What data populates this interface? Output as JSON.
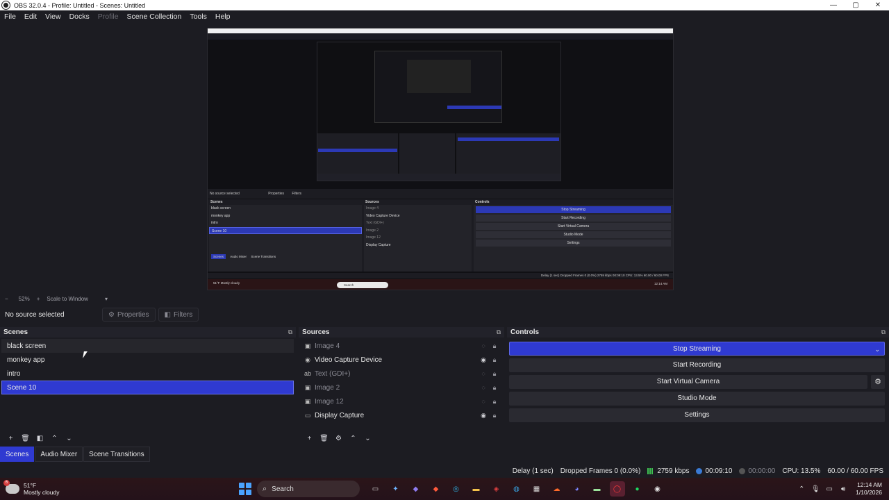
{
  "titlebar": {
    "title": "OBS 32.0.4 - Profile: Untitled - Scenes: Untitled",
    "min": "—",
    "max": "▢",
    "close": "✕"
  },
  "menu": [
    "File",
    "Edit",
    "View",
    "Docks",
    "Profile",
    "Scene Collection",
    "Tools",
    "Help"
  ],
  "menu_disabled": "Profile",
  "zoom": {
    "minus": "−",
    "percent": "52%",
    "plus": "+",
    "scale_mode": "Scale to Window",
    "caret": "▾"
  },
  "context": {
    "no_source": "No source selected",
    "properties": "Properties",
    "filters": "Filters"
  },
  "scenes": {
    "title": "Scenes",
    "items": [
      "black screen",
      "monkey app",
      "intro",
      "Scene 10"
    ],
    "selected": "Scene 10"
  },
  "sources": {
    "title": "Sources",
    "items": [
      {
        "name": "Image 4",
        "type": "image",
        "visible": false
      },
      {
        "name": "Video Capture Device",
        "type": "camera",
        "visible": true
      },
      {
        "name": "Text (GDI+)",
        "type": "text",
        "visible": false
      },
      {
        "name": "Image 2",
        "type": "image",
        "visible": false
      },
      {
        "name": "Image 12",
        "type": "image",
        "visible": false
      },
      {
        "name": "Display Capture",
        "type": "monitor",
        "visible": true
      }
    ]
  },
  "controls": {
    "title": "Controls",
    "stop_streaming": "Stop Streaming",
    "start_recording": "Start Recording",
    "start_virtual_camera": "Start Virtual Camera",
    "studio_mode": "Studio Mode",
    "settings": "Settings"
  },
  "tabs": [
    "Scenes",
    "Audio Mixer",
    "Scene Transitions"
  ],
  "status": {
    "delay": "Delay (1 sec)",
    "dropped": "Dropped Frames 0 (0.0%)",
    "bitrate": "2759 kbps",
    "stream_time": "00:09:10",
    "rec_time": "00:00:00",
    "cpu": "CPU: 13.5%",
    "fps": "60.00 / 60.00 FPS"
  },
  "taskbar": {
    "weather_temp": "51°F",
    "weather_desc": "Mostly cloudy",
    "weather_badge": "6",
    "search": "Search",
    "time": "12:14 AM",
    "date": "1/10/2026"
  },
  "preview_mini": {
    "no_source": "No source selected",
    "properties": "Properties",
    "filters": "Filters",
    "scenes_title": "Scenes",
    "sources_title": "Sources",
    "controls_title": "Controls",
    "scene_items": [
      "black screen",
      "monkey app",
      "intro",
      "Scene 10"
    ],
    "source_items": [
      "Image 4",
      "Video Capture Device",
      "Text (GDI+)",
      "Image 2",
      "Image 12",
      "Display Capture"
    ],
    "control_items": [
      "Stop Streaming",
      "Start Recording",
      "Start Virtual Camera",
      "Studio Mode",
      "Settings"
    ],
    "tabs": [
      "Scenes",
      "Audio Mixer",
      "Scene Transitions"
    ],
    "status": "Delay (1 sec)   Dropped Frames 0 (0.0%)   2759 kbps   00:09:10   CPU: 13.5%   60.00 / 60.00 FPS",
    "weather": "51°F Mostly cloudy",
    "search": "Search",
    "time": "12:14 AM"
  },
  "colors": {
    "accent": "#2f3ad1",
    "background": "#1c1c22",
    "signal": "#3ec152"
  }
}
